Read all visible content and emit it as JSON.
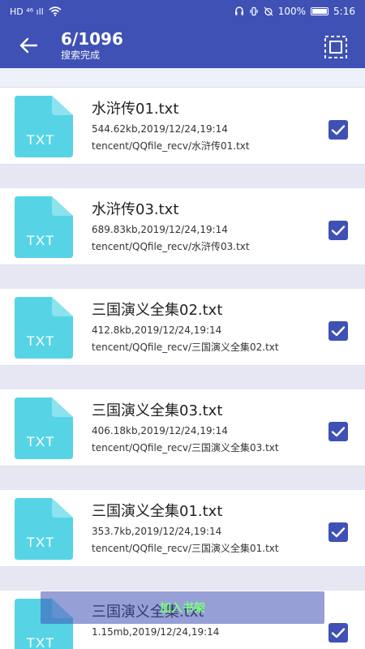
{
  "status_bar": {
    "left_text": "HD ⁴⁶ ıll",
    "battery": "100%",
    "time": "5:16"
  },
  "header": {
    "title": "6/1096",
    "subtitle": "搜索完成"
  },
  "files": [
    {
      "name": "水浒传01.txt",
      "meta": "544.62kb,2019/12/24,19:14",
      "path": "tencent/QQfile_recv/水浒传01.txt",
      "icon_label": "TXT",
      "checked": true
    },
    {
      "name": "水浒传03.txt",
      "meta": "689.83kb,2019/12/24,19:14",
      "path": "tencent/QQfile_recv/水浒传03.txt",
      "icon_label": "TXT",
      "checked": true
    },
    {
      "name": "三国演义全集02.txt",
      "meta": "412.8kb,2019/12/24,19:14",
      "path": "tencent/QQfile_recv/三国演义全集02.txt",
      "icon_label": "TXT",
      "checked": true
    },
    {
      "name": "三国演义全集03.txt",
      "meta": "406.18kb,2019/12/24,19:14",
      "path": "tencent/QQfile_recv/三国演义全集03.txt",
      "icon_label": "TXT",
      "checked": true
    },
    {
      "name": "三国演义全集01.txt",
      "meta": "353.7kb,2019/12/24,19:14",
      "path": "tencent/QQfile_recv/三国演义全集01.txt",
      "icon_label": "TXT",
      "checked": true
    },
    {
      "name": "三国演义全集.txt",
      "meta": "1.15mb,2019/12/24,19:14",
      "path": "",
      "icon_label": "TXT",
      "checked": true
    }
  ],
  "bottom_bar": {
    "label": "加入书架"
  },
  "colors": {
    "primary": "#3f51b5",
    "file_icon": "#56d4e6"
  }
}
